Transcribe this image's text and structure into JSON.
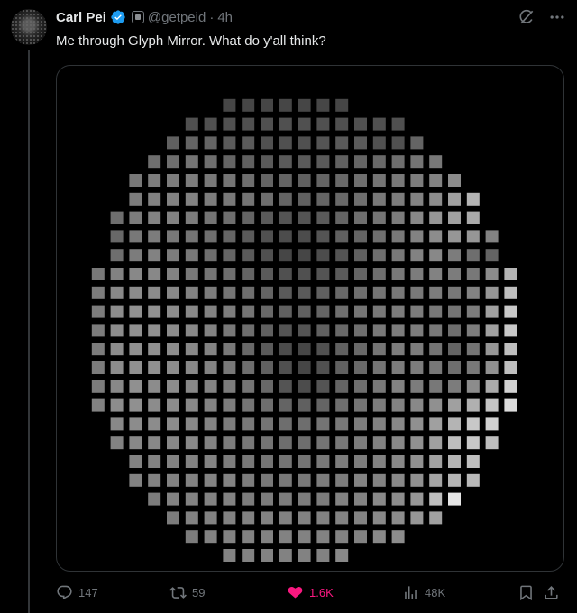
{
  "post": {
    "author_name": "Carl Pei",
    "handle": "@getpeid",
    "separator": "·",
    "time": "4h",
    "text": "Me through Glyph Mirror. What do y'all think?"
  },
  "stats": {
    "replies": "147",
    "reposts": "59",
    "likes": "1.6K",
    "views": "48K"
  },
  "colors": {
    "background": "#000000",
    "text": "#e7e9ea",
    "muted": "#71767b",
    "verified": "#1d9bf0",
    "like": "#f91880"
  },
  "icons": {
    "verified": "verified-badge-icon",
    "affiliate": "affiliate-badge-icon",
    "grok": "grok-icon",
    "more": "more-icon",
    "reply": "reply-icon",
    "repost": "repost-icon",
    "like": "heart-icon",
    "views": "views-icon",
    "bookmark": "bookmark-icon",
    "share": "share-icon"
  },
  "glyph_image": {
    "rows": [
      [
        0,
        0,
        0,
        0,
        0,
        0,
        0,
        0,
        0,
        0,
        0,
        0,
        0,
        0,
        0,
        0,
        0,
        0,
        0,
        0,
        0,
        0,
        0,
        0,
        0
      ],
      [
        0,
        0,
        0,
        0,
        0,
        0,
        0,
        0,
        0.15,
        0.15,
        0.15,
        0.15,
        0.15,
        0.15,
        0.15,
        0,
        0,
        0,
        0,
        0,
        0,
        0,
        0,
        0,
        0
      ],
      [
        0,
        0,
        0,
        0,
        0,
        0,
        0.2,
        0.2,
        0.2,
        0.2,
        0.2,
        0.2,
        0.2,
        0.2,
        0.2,
        0.2,
        0.2,
        0.2,
        0,
        0,
        0,
        0,
        0,
        0,
        0
      ],
      [
        0,
        0,
        0,
        0,
        0,
        0.28,
        0.3,
        0.3,
        0.25,
        0.25,
        0.2,
        0.2,
        0.2,
        0.22,
        0.25,
        0.25,
        0.2,
        0.2,
        0.3,
        0,
        0,
        0,
        0,
        0,
        0
      ],
      [
        0,
        0,
        0,
        0,
        0.35,
        0.35,
        0.38,
        0.35,
        0.3,
        0.28,
        0.25,
        0.25,
        0.25,
        0.25,
        0.28,
        0.3,
        0.32,
        0.35,
        0.38,
        0.4,
        0,
        0,
        0,
        0,
        0
      ],
      [
        0,
        0,
        0,
        0.4,
        0.42,
        0.42,
        0.42,
        0.4,
        0.38,
        0.35,
        0.3,
        0.3,
        0.28,
        0.3,
        0.32,
        0.35,
        0.38,
        0.4,
        0.42,
        0.45,
        0.5,
        0,
        0,
        0,
        0
      ],
      [
        0,
        0,
        0,
        0.42,
        0.45,
        0.45,
        0.45,
        0.42,
        0.4,
        0.38,
        0.35,
        0.3,
        0.28,
        0.3,
        0.32,
        0.35,
        0.4,
        0.42,
        0.45,
        0.5,
        0.6,
        0.7,
        0,
        0,
        0
      ],
      [
        0,
        0,
        0.35,
        0.42,
        0.45,
        0.45,
        0.42,
        0.38,
        0.35,
        0.3,
        0.25,
        0.22,
        0.22,
        0.25,
        0.3,
        0.35,
        0.38,
        0.42,
        0.48,
        0.55,
        0.6,
        0.65,
        0,
        0,
        0
      ],
      [
        0,
        0,
        0.32,
        0.4,
        0.42,
        0.4,
        0.38,
        0.35,
        0.3,
        0.25,
        0.2,
        0.18,
        0.18,
        0.22,
        0.28,
        0.3,
        0.35,
        0.4,
        0.45,
        0.5,
        0.55,
        0.55,
        0.45,
        0,
        0
      ],
      [
        0,
        0,
        0.35,
        0.42,
        0.45,
        0.42,
        0.4,
        0.35,
        0.3,
        0.25,
        0.2,
        0.15,
        0.15,
        0.18,
        0.22,
        0.28,
        0.35,
        0.4,
        0.45,
        0.48,
        0.42,
        0.35,
        0.3,
        0,
        0
      ],
      [
        0,
        0.4,
        0.45,
        0.48,
        0.48,
        0.45,
        0.4,
        0.38,
        0.35,
        0.3,
        0.25,
        0.2,
        0.2,
        0.22,
        0.25,
        0.3,
        0.35,
        0.4,
        0.42,
        0.45,
        0.42,
        0.4,
        0.5,
        0.7,
        0
      ],
      [
        0,
        0.42,
        0.48,
        0.5,
        0.5,
        0.48,
        0.45,
        0.42,
        0.38,
        0.35,
        0.3,
        0.25,
        0.25,
        0.28,
        0.32,
        0.35,
        0.38,
        0.4,
        0.4,
        0.42,
        0.4,
        0.45,
        0.55,
        0.75,
        0
      ],
      [
        0,
        0.42,
        0.5,
        0.52,
        0.52,
        0.5,
        0.48,
        0.45,
        0.42,
        0.38,
        0.32,
        0.28,
        0.28,
        0.3,
        0.35,
        0.38,
        0.4,
        0.42,
        0.42,
        0.4,
        0.38,
        0.42,
        0.6,
        0.8,
        0
      ],
      [
        0,
        0.42,
        0.5,
        0.52,
        0.52,
        0.5,
        0.48,
        0.45,
        0.4,
        0.35,
        0.28,
        0.22,
        0.22,
        0.28,
        0.32,
        0.35,
        0.4,
        0.42,
        0.42,
        0.4,
        0.35,
        0.42,
        0.6,
        0.8,
        0
      ],
      [
        0,
        0.42,
        0.5,
        0.52,
        0.52,
        0.5,
        0.48,
        0.45,
        0.4,
        0.32,
        0.25,
        0.18,
        0.15,
        0.2,
        0.28,
        0.32,
        0.38,
        0.42,
        0.42,
        0.38,
        0.3,
        0.38,
        0.55,
        0.75,
        0
      ],
      [
        0,
        0.42,
        0.5,
        0.52,
        0.52,
        0.5,
        0.48,
        0.45,
        0.4,
        0.35,
        0.28,
        0.2,
        0.15,
        0.2,
        0.28,
        0.32,
        0.38,
        0.42,
        0.42,
        0.4,
        0.35,
        0.4,
        0.52,
        0.75,
        0
      ],
      [
        0,
        0.42,
        0.48,
        0.52,
        0.5,
        0.5,
        0.48,
        0.45,
        0.42,
        0.38,
        0.32,
        0.22,
        0.18,
        0.22,
        0.3,
        0.35,
        0.4,
        0.45,
        0.42,
        0.4,
        0.42,
        0.5,
        0.65,
        0.85,
        0
      ],
      [
        0,
        0.45,
        0.5,
        0.52,
        0.5,
        0.5,
        0.48,
        0.45,
        0.42,
        0.38,
        0.35,
        0.3,
        0.28,
        0.3,
        0.35,
        0.38,
        0.42,
        0.45,
        0.48,
        0.52,
        0.6,
        0.68,
        0.78,
        0.9,
        0
      ],
      [
        0,
        0,
        0.48,
        0.5,
        0.5,
        0.5,
        0.48,
        0.45,
        0.42,
        0.4,
        0.38,
        0.35,
        0.35,
        0.38,
        0.4,
        0.42,
        0.45,
        0.48,
        0.52,
        0.6,
        0.7,
        0.8,
        0.85,
        0,
        0
      ],
      [
        0,
        0,
        0.45,
        0.48,
        0.48,
        0.48,
        0.48,
        0.45,
        0.42,
        0.4,
        0.38,
        0.35,
        0.35,
        0.38,
        0.4,
        0.42,
        0.45,
        0.48,
        0.52,
        0.6,
        0.75,
        0.8,
        0.75,
        0,
        0
      ],
      [
        0,
        0,
        0,
        0.45,
        0.45,
        0.45,
        0.45,
        0.45,
        0.42,
        0.4,
        0.38,
        0.38,
        0.38,
        0.4,
        0.42,
        0.42,
        0.45,
        0.48,
        0.52,
        0.6,
        0.7,
        0.75,
        0,
        0,
        0
      ],
      [
        0,
        0,
        0,
        0.45,
        0.45,
        0.45,
        0.45,
        0.45,
        0.45,
        0.42,
        0.4,
        0.4,
        0.4,
        0.42,
        0.42,
        0.45,
        0.45,
        0.48,
        0.52,
        0.62,
        0.7,
        0.72,
        0,
        0,
        0
      ],
      [
        0,
        0,
        0,
        0,
        0.42,
        0.45,
        0.45,
        0.45,
        0.45,
        0.42,
        0.42,
        0.42,
        0.42,
        0.42,
        0.45,
        0.45,
        0.48,
        0.5,
        0.55,
        0.75,
        0.95,
        0,
        0,
        0,
        0
      ],
      [
        0,
        0,
        0,
        0,
        0,
        0.42,
        0.45,
        0.45,
        0.45,
        0.45,
        0.45,
        0.45,
        0.45,
        0.45,
        0.45,
        0.45,
        0.48,
        0.5,
        0.55,
        0.6,
        0,
        0,
        0,
        0,
        0
      ],
      [
        0,
        0,
        0,
        0,
        0,
        0,
        0.42,
        0.45,
        0.45,
        0.45,
        0.45,
        0.45,
        0.45,
        0.45,
        0.45,
        0.45,
        0.48,
        0.5,
        0,
        0,
        0,
        0,
        0,
        0,
        0
      ],
      [
        0,
        0,
        0,
        0,
        0,
        0,
        0,
        0,
        0.45,
        0.45,
        0.45,
        0.45,
        0.45,
        0.45,
        0.48,
        0,
        0,
        0,
        0,
        0,
        0,
        0,
        0,
        0,
        0
      ]
    ]
  }
}
